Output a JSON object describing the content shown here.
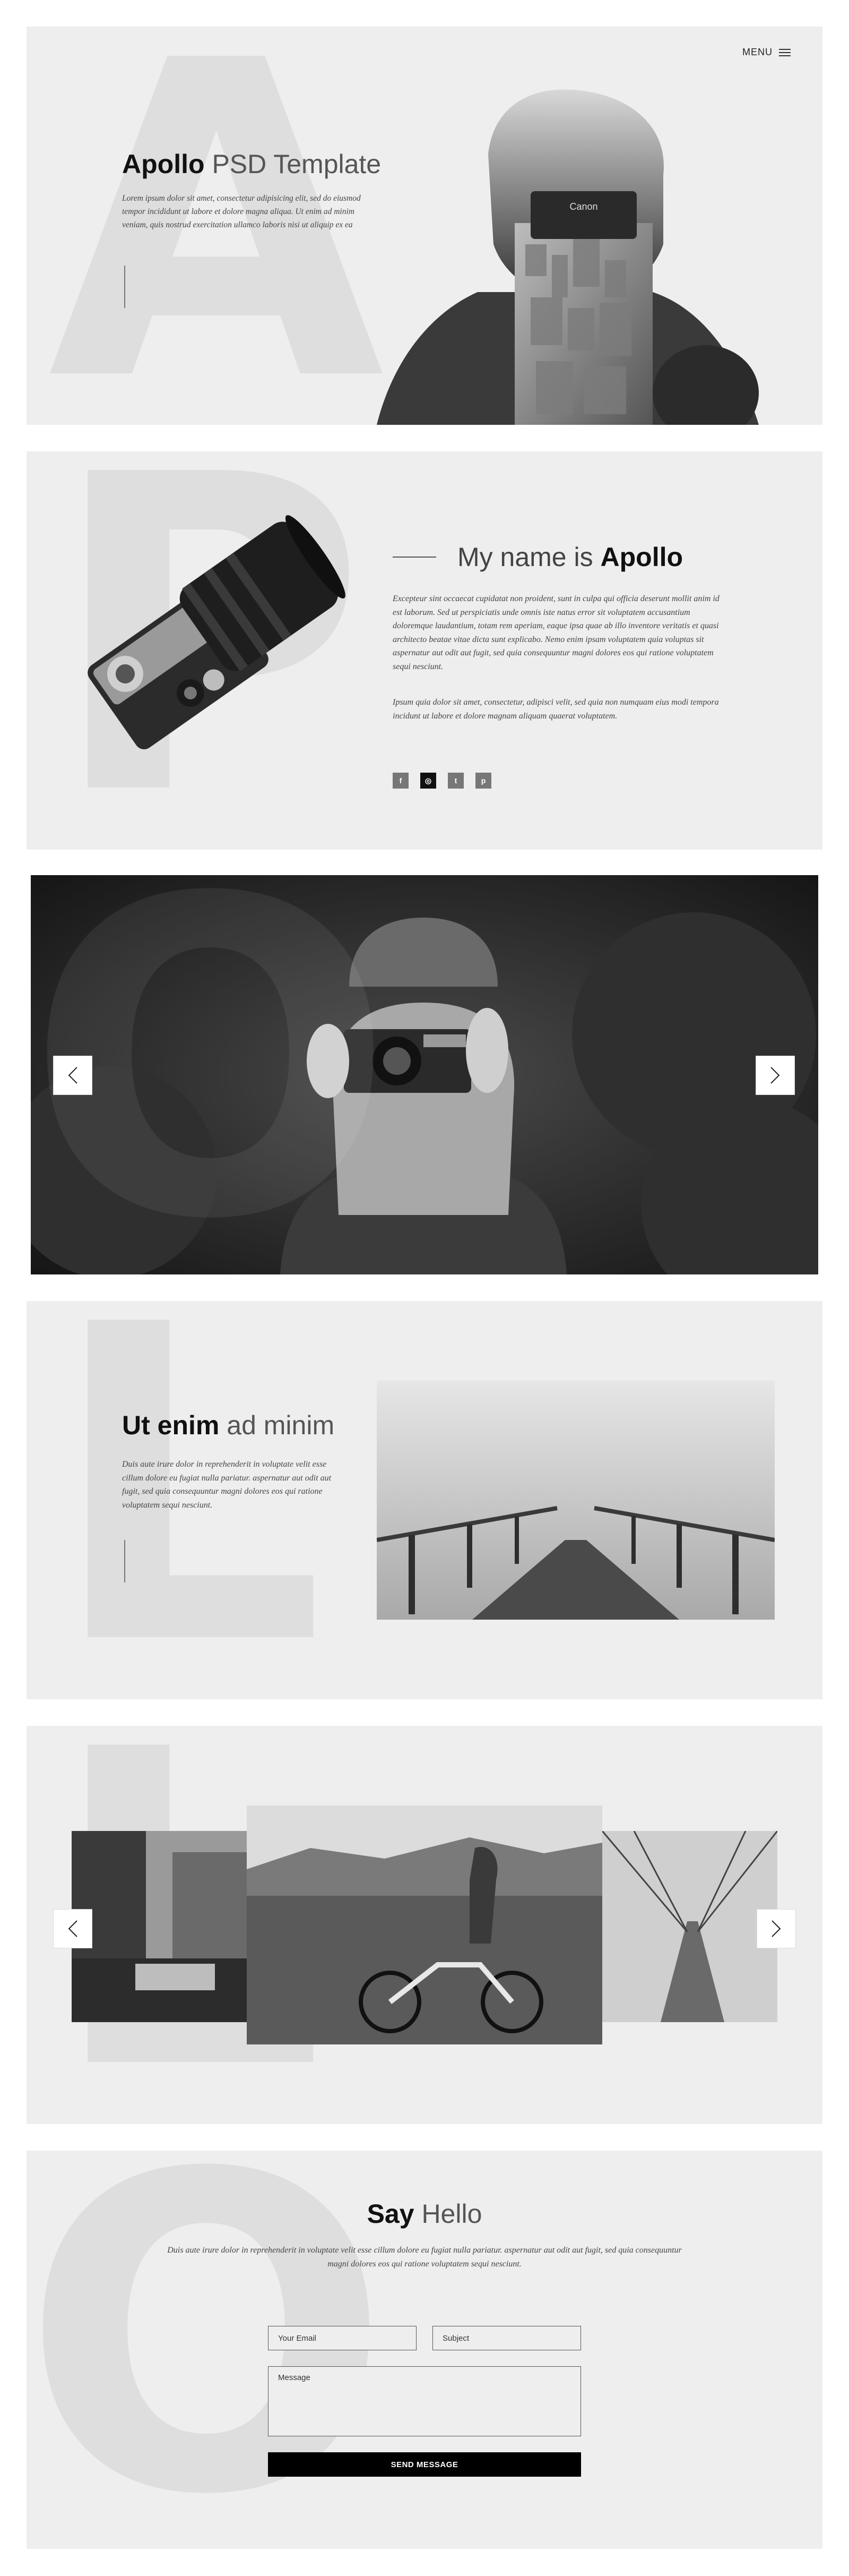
{
  "hero": {
    "big_letter": "A",
    "menu_label": "MENU",
    "title_bold": "Apollo",
    "title_light": "PSD Template",
    "text": "Lorem ipsum dolor sit amet, consectetur adipisicing elit, sed do eiusmod tempor incididunt ut labore et dolore magna aliqua. Ut enim ad minim veniam, quis nostrud exercitation ullamco laboris nisi ut aliquip ex ea"
  },
  "about": {
    "big_letter": "P",
    "title_light": "My name is",
    "title_bold": "Apollo",
    "para1": "Excepteur sint occaecat cupidatat non proident, sunt in culpa qui officia deserunt mollit anim id est laborum. Sed ut perspiciatis unde omnis iste natus error sit voluptatem accusantium doloremque laudantium, totam rem aperiam, eaque ipsa quae ab illo inventore veritatis et quasi architecto beatae vitae dicta sunt explicabo. Nemo enim ipsam voluptatem quia voluptas sit aspernatur aut odit aut fugit, sed quia consequuntur magni dolores eos qui ratione voluptatem sequi nesciunt.",
    "para2": "Ipsum quia dolor sit amet, consectetur, adipisci velit, sed quia non numquam eius modi tempora incidunt ut labore et dolore magnam aliquam quaerat voluptatem.",
    "social": [
      {
        "glyph": "f",
        "icon": "facebook-icon"
      },
      {
        "glyph": "◎",
        "icon": "instagram-icon"
      },
      {
        "glyph": "t",
        "icon": "twitter-icon"
      },
      {
        "glyph": "p",
        "icon": "pinterest-icon"
      }
    ]
  },
  "slider1": {
    "big_letter": "O"
  },
  "feature": {
    "big_letter": "L",
    "title_bold": "Ut enim",
    "title_light": "ad minim",
    "text": "Duis aute irure dolor in reprehenderit in voluptate velit esse cillum dolore eu fugiat nulla pariatur. aspernatur aut odit aut fugit, sed quia consequuntur magni dolores eos qui ratione voluptatem sequi nesciunt."
  },
  "gallery": {
    "big_letter": "L"
  },
  "contact": {
    "big_letter": "O",
    "title_bold": "Say",
    "title_light": "Hello",
    "text": "Duis aute irure dolor in reprehenderit in voluptate velit esse cillum dolore eu fugiat nulla pariatur. aspernatur aut odit aut fugit, sed quia consequuntur magni dolores eos qui ratione voluptatem sequi nesciunt.",
    "email_placeholder": "Your Email",
    "subject_placeholder": "Subject",
    "message_placeholder": "Message",
    "submit_label": "SEND MESSAGE"
  }
}
